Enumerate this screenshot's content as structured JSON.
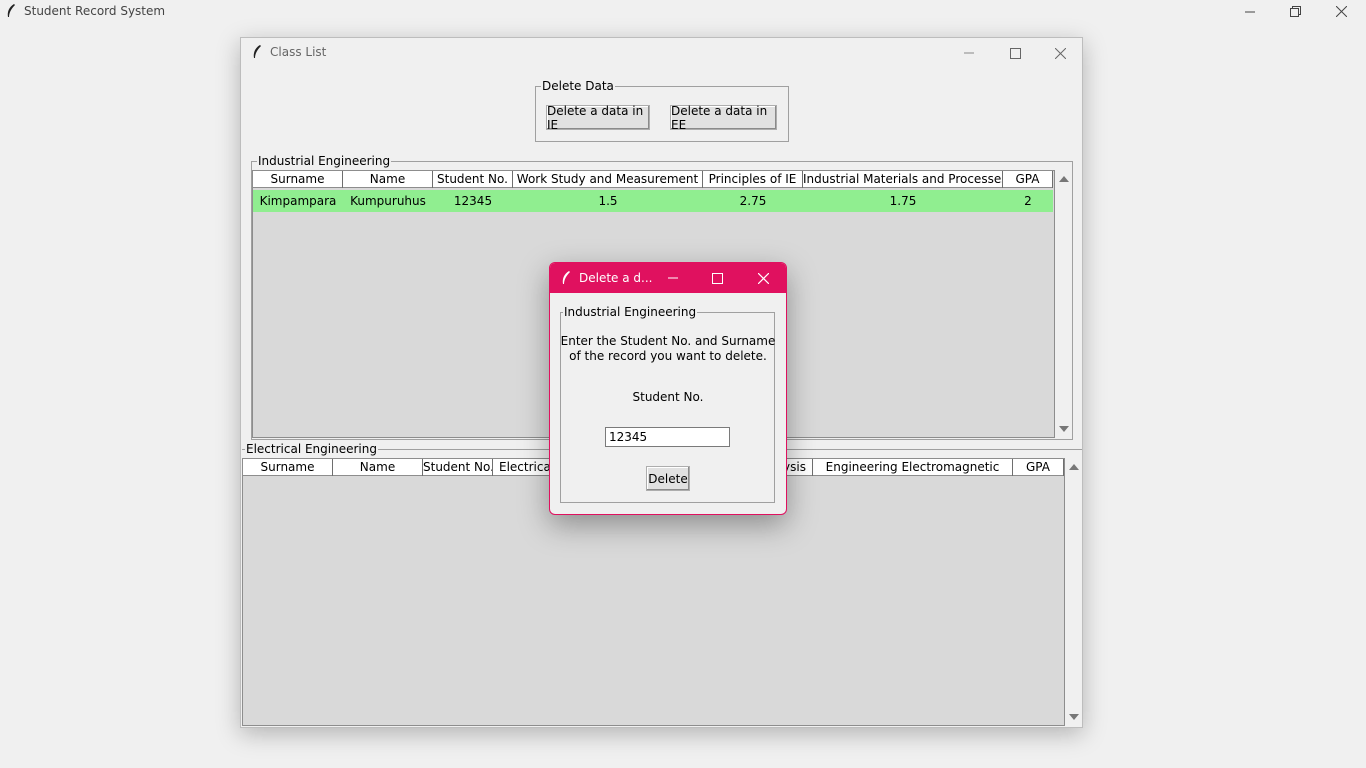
{
  "app": {
    "title": "Student Record System"
  },
  "class_list": {
    "title": "Class List",
    "delete_frame": {
      "legend": "Delete Data",
      "buttons": [
        "Delete a data in IE",
        "Delete a data in EE"
      ]
    },
    "ie": {
      "legend": "Industrial Engineering",
      "columns": [
        "Surname",
        "Name",
        "Student No.",
        "Work Study and Measurement",
        "Principles of IE",
        "Industrial Materials and Processes",
        "GPA"
      ],
      "rows": [
        [
          "Kimpampara",
          "Kumpuruhus",
          "12345",
          "1.5",
          "2.75",
          "1.75",
          "2"
        ]
      ],
      "row_color": "#90ee90"
    },
    "ee": {
      "legend": "Electrical Engineering",
      "columns": [
        "Surname",
        "Name",
        "Student No.",
        "Electrical",
        "ysis",
        "Engineering Electromagnetic",
        "GPA"
      ]
    }
  },
  "dialog": {
    "title": "Delete a d...",
    "accent": "#e0115f",
    "legend": "Industrial Engineering",
    "instruction_line1": "Enter the Student No. and Surname",
    "instruction_line2": "of the record you want to delete.",
    "field_label": "Student No.",
    "field_value": "12345",
    "delete_label": "Delete"
  },
  "icons": [
    "feather-icon",
    "minimize-icon",
    "maximize-icon",
    "restore-icon",
    "close-icon",
    "scroll-up-icon",
    "scroll-down-icon"
  ]
}
